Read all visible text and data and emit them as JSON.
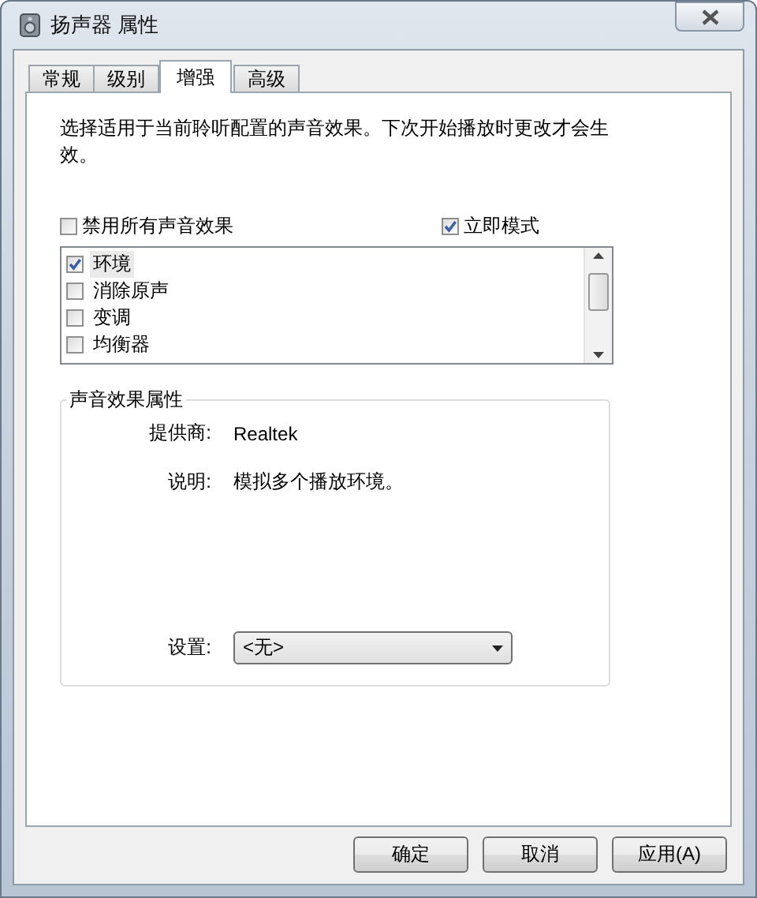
{
  "window": {
    "title": "扬声器 属性"
  },
  "tabs": [
    {
      "label": "常规",
      "selected": false
    },
    {
      "label": "级别",
      "selected": false
    },
    {
      "label": "增强",
      "selected": true
    },
    {
      "label": "高级",
      "selected": false
    }
  ],
  "description": "选择适用于当前聆听配置的声音效果。下次开始播放时更改才会生效。",
  "options": [
    {
      "label": "禁用所有声音效果",
      "checked": false
    },
    {
      "label": "立即模式",
      "checked": true
    }
  ],
  "effects": [
    {
      "label": "环境",
      "checked": true,
      "selected": true
    },
    {
      "label": "消除原声",
      "checked": false,
      "selected": false
    },
    {
      "label": "变调",
      "checked": false,
      "selected": false
    },
    {
      "label": "均衡器",
      "checked": false,
      "selected": false
    }
  ],
  "properties": {
    "title": "声音效果属性",
    "provider_label": "提供商:",
    "provider": "Realtek",
    "description_label": "说明:",
    "description": "模拟多个播放环境。",
    "setting_label": "设置:",
    "setting": "<无>"
  },
  "buttons": [
    "确定",
    "取消",
    "应用(A)"
  ]
}
